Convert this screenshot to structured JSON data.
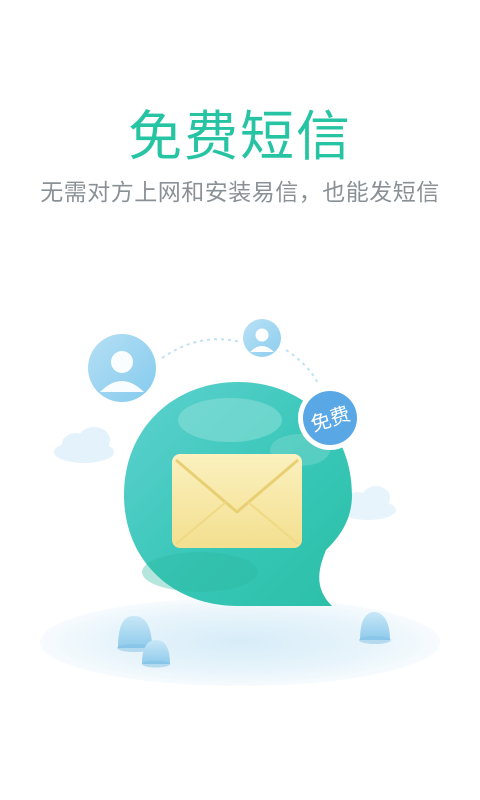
{
  "screen": {
    "title": "免费短信",
    "subtitle": "无需对方上网和安装易信，也能发短信"
  },
  "illustration": {
    "badge_text": "免费",
    "icons": [
      "contact-avatar-icon",
      "contact-avatar-icon",
      "envelope-icon",
      "chat-bubble-icon",
      "cloud-icon"
    ]
  },
  "colors": {
    "accent": "#27c4a4",
    "subtitle": "#8a9196",
    "badge": "#5aa7e6",
    "envelope": "#f6e7a3"
  }
}
